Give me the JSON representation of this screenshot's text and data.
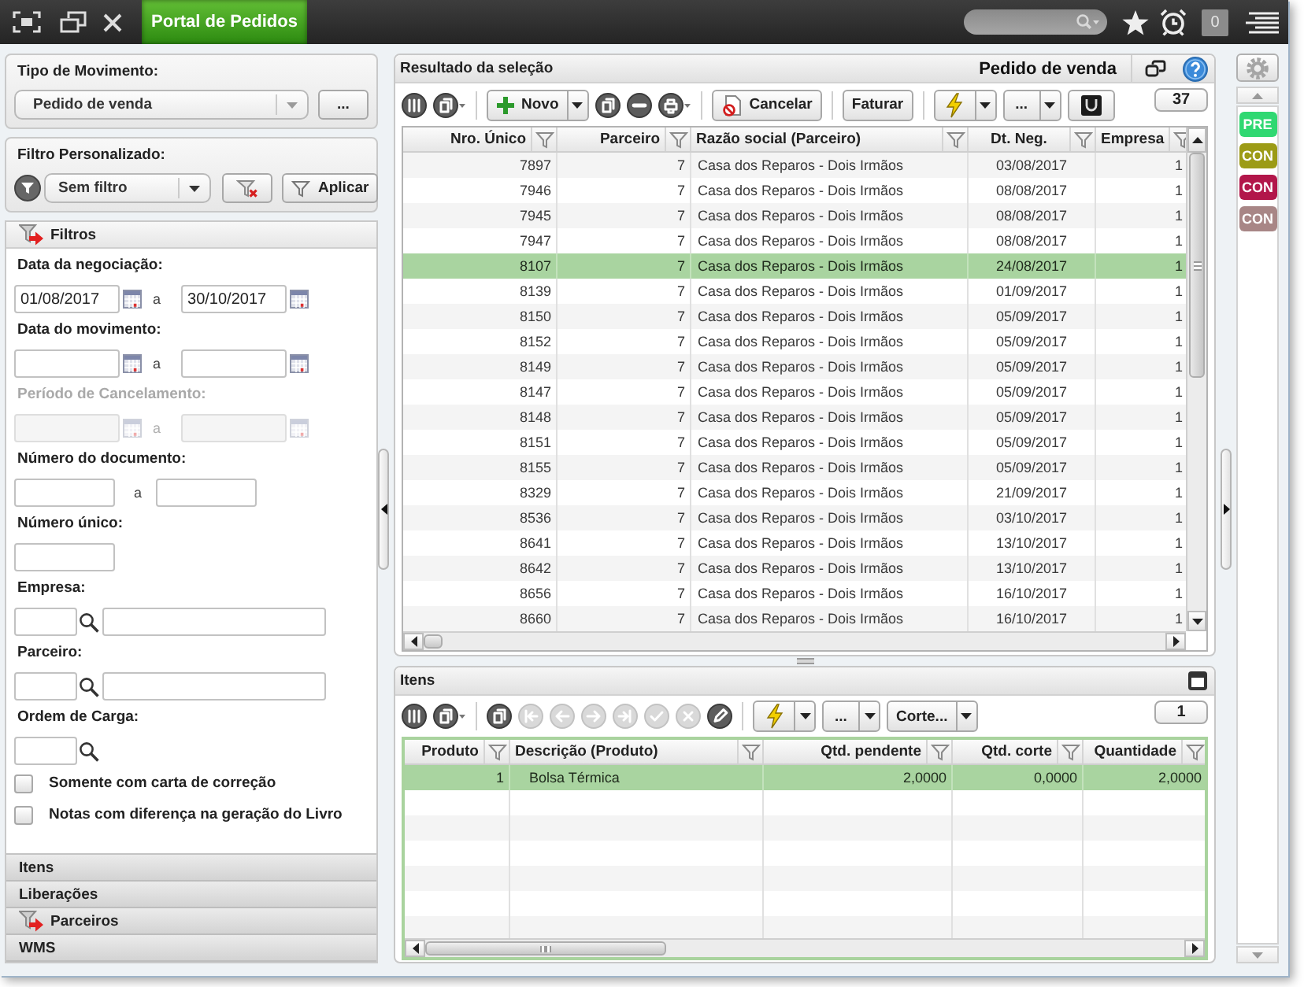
{
  "top_bar": {
    "app_tab": {
      "label": "Portal de Pedidos",
      "selected": true
    },
    "notification_count": "0"
  },
  "left_panel": {
    "movement_type": {
      "label": "Tipo de Movimento:",
      "value": "Pedido de venda",
      "more_button": "..."
    },
    "custom_filter": {
      "label": "Filtro Personalizado:",
      "value": "Sem filtro",
      "apply_button": "Aplicar"
    },
    "sections": [
      {
        "label": "Filtros",
        "expanded": true,
        "filter_active": true,
        "fields": [
          {
            "kind": "date_range",
            "label": "Data da negociação:",
            "disabled": false,
            "from": "01/08/2017",
            "separator": "a",
            "to": "30/10/2017"
          },
          {
            "kind": "date_range",
            "label": "Data do movimento:",
            "disabled": false,
            "separator": "a"
          },
          {
            "kind": "date_range",
            "label": "Período de Cancelamento:",
            "disabled": true,
            "separator": "a"
          },
          {
            "kind": "range",
            "label": "Número do documento:",
            "disabled": false,
            "separator": "a"
          },
          {
            "kind": "single",
            "label": "Número único:",
            "disabled": false
          },
          {
            "kind": "lookup",
            "label": "Empresa:",
            "disabled": false,
            "description_field": true
          },
          {
            "kind": "lookup",
            "label": "Parceiro:",
            "disabled": false,
            "description_field": true
          },
          {
            "kind": "lookup",
            "label": "Ordem de Carga:",
            "disabled": false,
            "description_field": false
          },
          {
            "kind": "checkbox",
            "label": "Somente com carta de correção",
            "disabled": false,
            "checked": false
          },
          {
            "kind": "checkbox",
            "label": "Notas com diferença na geração do Livro",
            "disabled": false,
            "checked": false
          }
        ]
      },
      {
        "label": "Itens",
        "expanded": false,
        "filter_active": false
      },
      {
        "label": "Liberações",
        "expanded": false,
        "filter_active": false
      },
      {
        "label": "Parceiros",
        "expanded": false,
        "filter_active": true
      },
      {
        "label": "WMS",
        "expanded": false,
        "filter_active": false
      }
    ]
  },
  "results": {
    "title": "Resultado da seleção",
    "document_type": "Pedido de venda",
    "toolbar": {
      "new_button": "Novo",
      "cancel_button": "Cancelar",
      "invoice_button": "Faturar",
      "more_button": "...",
      "count": "37"
    },
    "table": {
      "columns": [
        {
          "label": "Nro. Único",
          "kind": "number"
        },
        {
          "label": "Parceiro",
          "kind": "number"
        },
        {
          "label": "Razão social (Parceiro)",
          "kind": "text"
        },
        {
          "label": "Dt. Neg.",
          "kind": "date"
        },
        {
          "label": "Empresa",
          "kind": "number"
        }
      ],
      "rows": [
        {
          "cells": [
            "7897",
            "7",
            "Casa dos Reparos - Dois Irmãos",
            "03/08/2017",
            "1"
          ],
          "selected": false
        },
        {
          "cells": [
            "7946",
            "7",
            "Casa dos Reparos - Dois Irmãos",
            "08/08/2017",
            "1"
          ],
          "selected": false
        },
        {
          "cells": [
            "7945",
            "7",
            "Casa dos Reparos - Dois Irmãos",
            "08/08/2017",
            "1"
          ],
          "selected": false
        },
        {
          "cells": [
            "7947",
            "7",
            "Casa dos Reparos - Dois Irmãos",
            "08/08/2017",
            "1"
          ],
          "selected": false
        },
        {
          "cells": [
            "8107",
            "7",
            "Casa dos Reparos - Dois Irmãos",
            "24/08/2017",
            "1"
          ],
          "selected": true
        },
        {
          "cells": [
            "8139",
            "7",
            "Casa dos Reparos - Dois Irmãos",
            "01/09/2017",
            "1"
          ],
          "selected": false
        },
        {
          "cells": [
            "8150",
            "7",
            "Casa dos Reparos - Dois Irmãos",
            "05/09/2017",
            "1"
          ],
          "selected": false
        },
        {
          "cells": [
            "8152",
            "7",
            "Casa dos Reparos - Dois Irmãos",
            "05/09/2017",
            "1"
          ],
          "selected": false
        },
        {
          "cells": [
            "8149",
            "7",
            "Casa dos Reparos - Dois Irmãos",
            "05/09/2017",
            "1"
          ],
          "selected": false
        },
        {
          "cells": [
            "8147",
            "7",
            "Casa dos Reparos - Dois Irmãos",
            "05/09/2017",
            "1"
          ],
          "selected": false
        },
        {
          "cells": [
            "8148",
            "7",
            "Casa dos Reparos - Dois Irmãos",
            "05/09/2017",
            "1"
          ],
          "selected": false
        },
        {
          "cells": [
            "8151",
            "7",
            "Casa dos Reparos - Dois Irmãos",
            "05/09/2017",
            "1"
          ],
          "selected": false
        },
        {
          "cells": [
            "8155",
            "7",
            "Casa dos Reparos - Dois Irmãos",
            "05/09/2017",
            "1"
          ],
          "selected": false
        },
        {
          "cells": [
            "8329",
            "7",
            "Casa dos Reparos - Dois Irmãos",
            "21/09/2017",
            "1"
          ],
          "selected": false
        },
        {
          "cells": [
            "8536",
            "7",
            "Casa dos Reparos - Dois Irmãos",
            "03/10/2017",
            "1"
          ],
          "selected": false
        },
        {
          "cells": [
            "8641",
            "7",
            "Casa dos Reparos - Dois Irmãos",
            "13/10/2017",
            "1"
          ],
          "selected": false
        },
        {
          "cells": [
            "8642",
            "7",
            "Casa dos Reparos - Dois Irmãos",
            "13/10/2017",
            "1"
          ],
          "selected": false
        },
        {
          "cells": [
            "8656",
            "7",
            "Casa dos Reparos - Dois Irmãos",
            "16/10/2017",
            "1"
          ],
          "selected": false
        },
        {
          "cells": [
            "8660",
            "7",
            "Casa dos Reparos - Dois Irmãos",
            "16/10/2017",
            "1"
          ],
          "selected": false
        }
      ]
    }
  },
  "items": {
    "title": "Itens",
    "toolbar": {
      "record_buttons_disabled": true,
      "more_button": "...",
      "cut_button": "Corte...",
      "count": "1"
    },
    "table": {
      "columns": [
        {
          "label": "Produto",
          "kind": "number"
        },
        {
          "label": "Descrição (Produto)",
          "kind": "text"
        },
        {
          "label": "Qtd. pendente",
          "kind": "number"
        },
        {
          "label": "Qtd. corte",
          "kind": "number"
        },
        {
          "label": "Quantidade",
          "kind": "number"
        }
      ],
      "rows": [
        {
          "cells": [
            "1",
            "Bolsa Térmica",
            "2,0000",
            "0,0000",
            "2,0000"
          ],
          "selected": true
        }
      ]
    }
  },
  "status_sidebar": {
    "badges": [
      {
        "label": "PRE",
        "color": "#30d872"
      },
      {
        "label": "CON",
        "color": "#9c9b16"
      },
      {
        "label": "CON",
        "color": "#b2164a"
      },
      {
        "label": "CON",
        "color": "#a88686"
      }
    ]
  }
}
